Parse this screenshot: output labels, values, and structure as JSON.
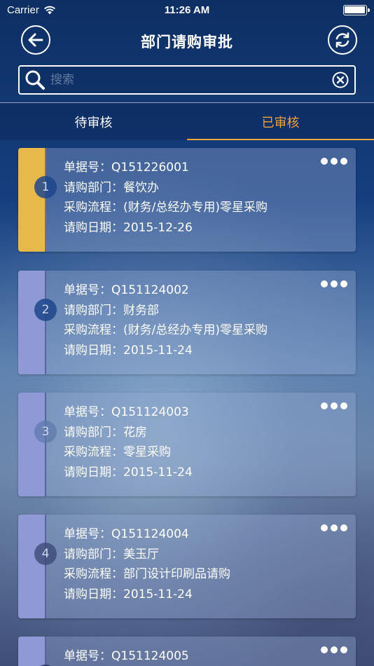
{
  "status_bar": {
    "carrier": "Carrier",
    "time": "11:26 AM"
  },
  "nav": {
    "title": "部门请购审批"
  },
  "search": {
    "placeholder": "搜索"
  },
  "tabs": [
    {
      "label": "待审核",
      "active": false
    },
    {
      "label": "已审核",
      "active": true
    }
  ],
  "colors": {
    "accent": "#f0a23a",
    "strip_selected": "#e6b94a",
    "strip_default": "#8f99d6"
  },
  "labels": {
    "doc_no": "单据号：",
    "dept": "请购部门：",
    "flow": "采购流程：",
    "date": "请购日期："
  },
  "cards": [
    {
      "index": "1",
      "doc_no": "Q151226001",
      "dept": "餐饮办",
      "flow": "(财务/总经办专用)零星采购",
      "date": "2015-12-26",
      "selected": true
    },
    {
      "index": "2",
      "doc_no": "Q151124002",
      "dept": "财务部",
      "flow": "(财务/总经办专用)零星采购",
      "date": "2015-11-24",
      "selected": false
    },
    {
      "index": "3",
      "doc_no": "Q151124003",
      "dept": "花房",
      "flow": "零星采购",
      "date": "2015-11-24",
      "selected": false
    },
    {
      "index": "4",
      "doc_no": "Q151124004",
      "dept": "美玉厅",
      "flow": "部门设计印刷品请购",
      "date": "2015-11-24",
      "selected": false
    },
    {
      "index": "5",
      "doc_no": "Q151124005",
      "dept": "",
      "flow": "",
      "date": "",
      "selected": false
    }
  ]
}
